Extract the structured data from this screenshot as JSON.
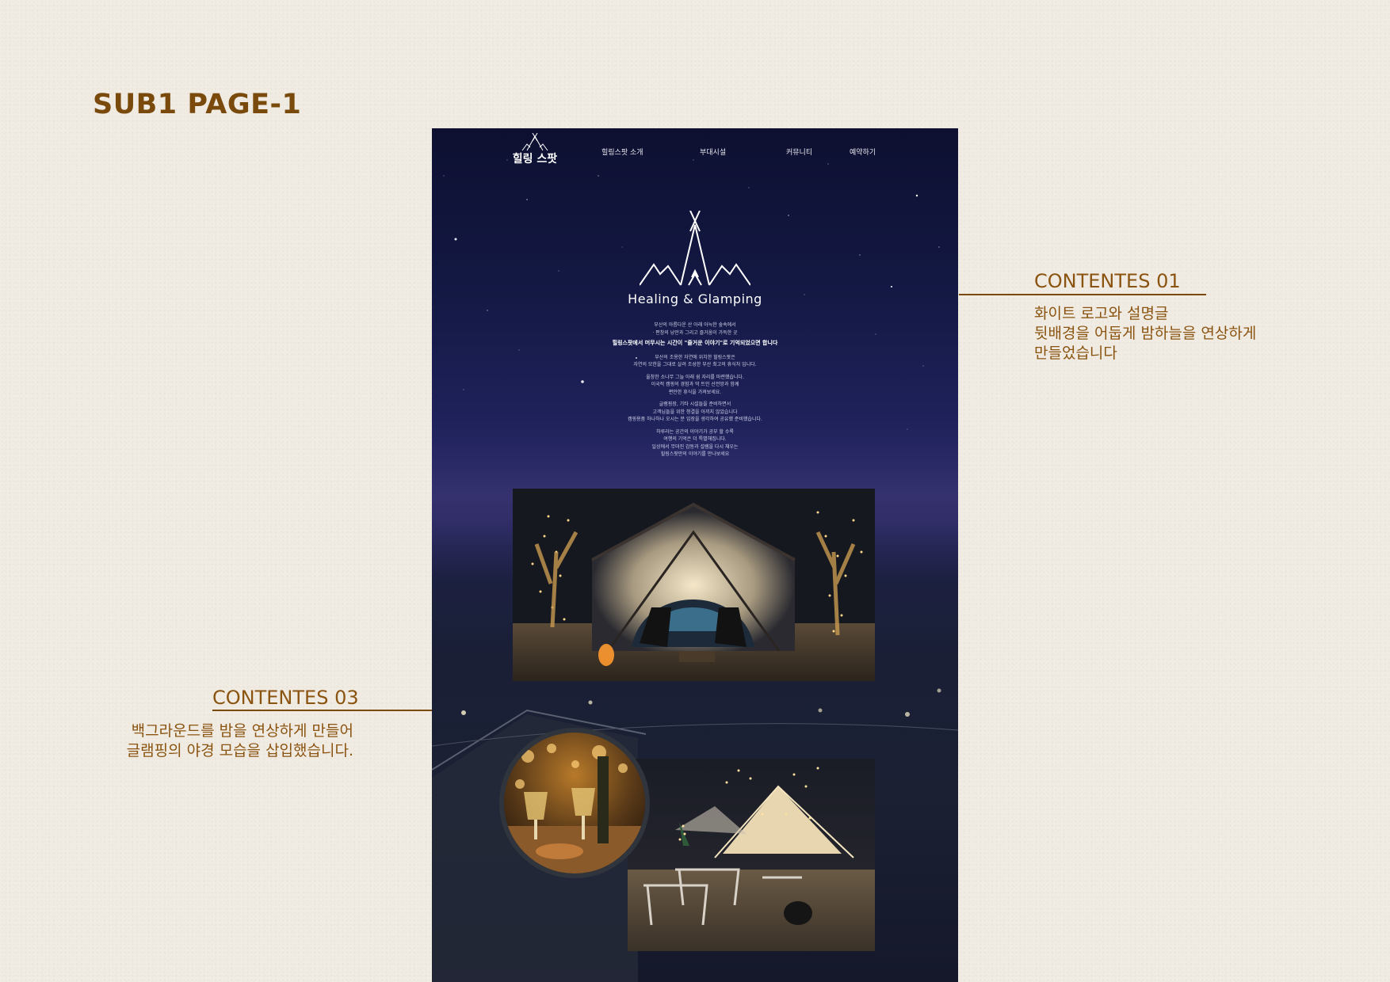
{
  "page_heading": "SUB1 PAGE-1",
  "annotations": {
    "contents01": {
      "title": "CONTENTES 01",
      "lines": [
        "화이트 로고와 설명글",
        "뒷배경을 어둡게 밤하늘을 연상하게",
        "만들었습니다"
      ]
    },
    "contents03": {
      "title": "CONTENTES 03",
      "lines": [
        "백그라운드를 밤을 연상하게 만들어",
        "글램핑의 야경 모습을 삽입했습니다."
      ]
    }
  },
  "site": {
    "logo_text": "힐링 스팟",
    "nav": [
      "힐링스팟 소개",
      "부대시설",
      "커뮤니티",
      "예약하기"
    ],
    "hero_title": "Healing & Glamping",
    "hero_lines_1": [
      "부산의 아름다운 산 아래 아늑한 숲속에서",
      "· 편창의 낭만과 그리고 즐거움이 가득한 곳"
    ],
    "hero_bold": "힐링스팟에서 머무시는 시간이 \"즐거운 이야기\"로 기억되었으면 합니다",
    "hero_lines_2": [
      "부산의 조용한 자연에 위치한 힐링스팟은",
      "자연의 모한을 그대로 살려 조성한 부산 최고의 휴식처 입니다."
    ],
    "hero_lines_3": [
      "울창한 소나무 그늘 아래 쉼 자리를 마련했습니다.",
      "이국적 캠핑의 경험과 딱 트인 산전망과 함께",
      "편안한 휴식을 가져보세요."
    ],
    "hero_lines_4": [
      "글램핑장, 기타 시설들을 준비하면서",
      "고객님들을 위한 청결을 아끼지 않았습니다",
      "캠핑용품 하나하나 오시는 분 입장을 생각하여 공유했 준비했습니다."
    ],
    "hero_lines_5": [
      "하루라는 공간의 이야기가 공부 할 수록",
      "여행의 기억은 더 특별해집니다.",
      "일상에서 무뎌진 감동과 설렘을 다시 채우는",
      "힐링스팟만의 이야기를 만나보세요"
    ]
  },
  "colors": {
    "accent": "#8a5410",
    "heading": "#7a4a0c",
    "page_bg": "#f1ece3"
  }
}
